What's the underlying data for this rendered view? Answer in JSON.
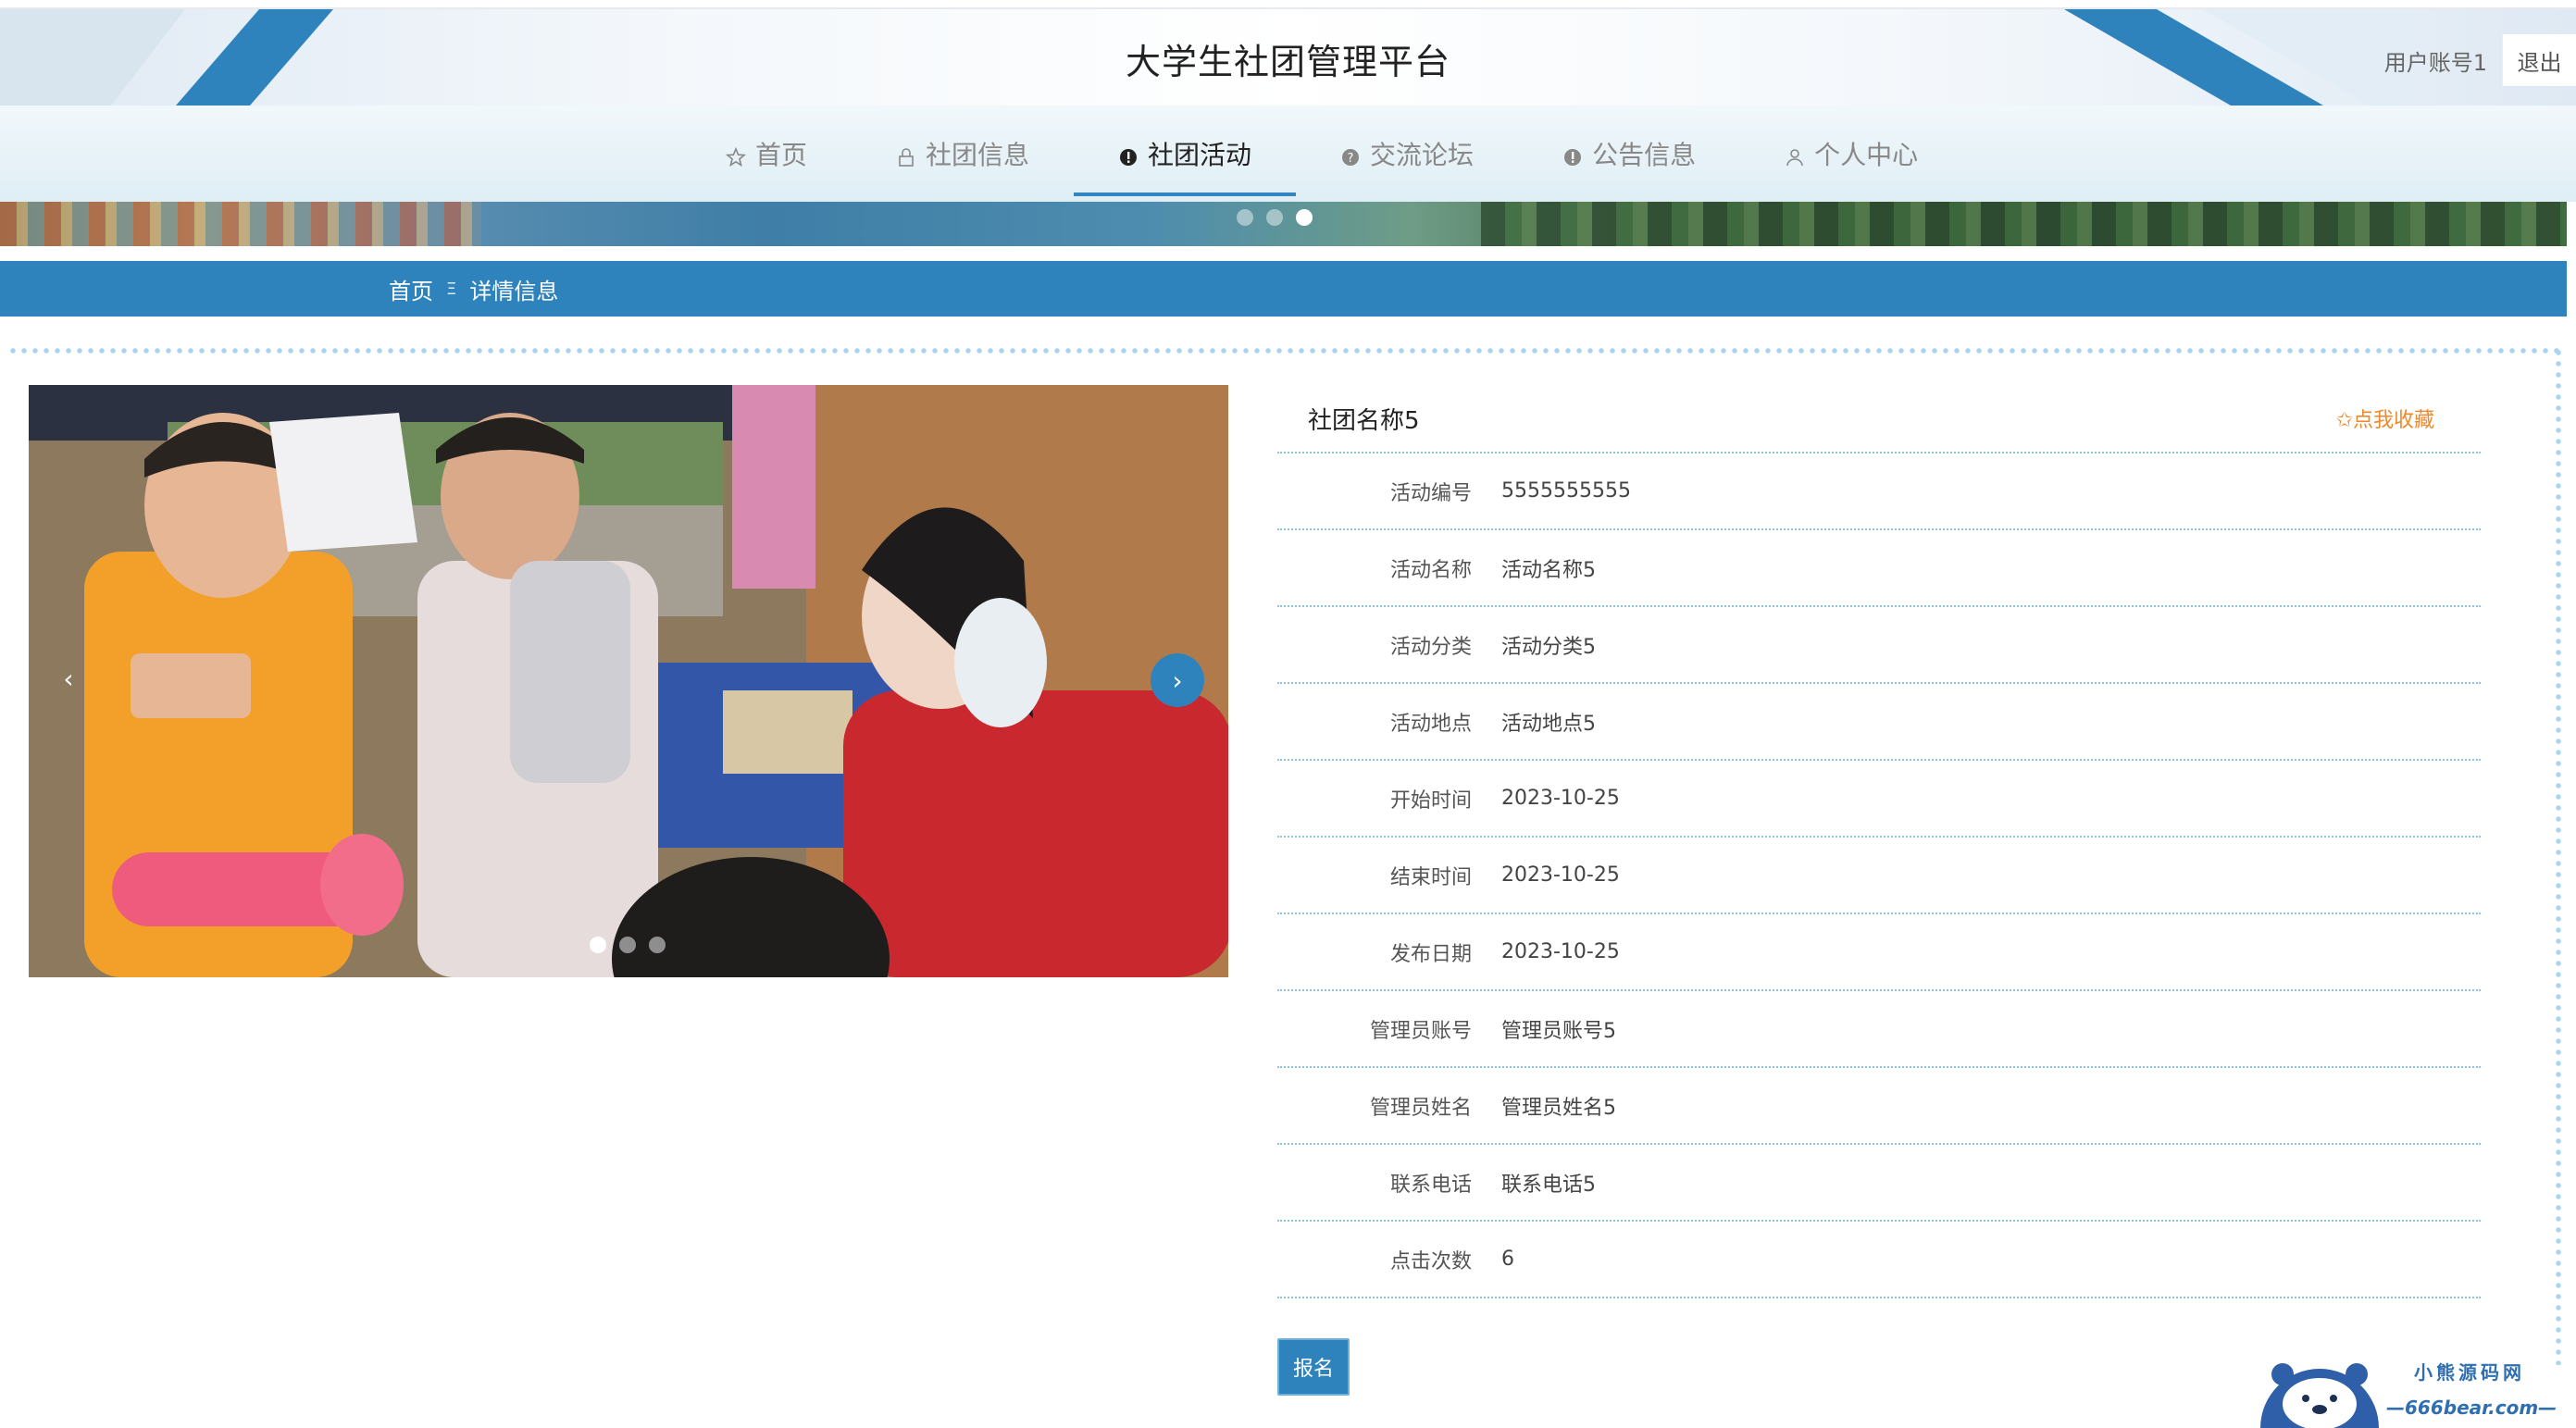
{
  "header": {
    "title": "大学生社团管理平台",
    "user_account": "用户账号1",
    "logout_label": "退出"
  },
  "nav": {
    "items": [
      {
        "label": "首页",
        "icon": "star-icon"
      },
      {
        "label": "社团信息",
        "icon": "lock-icon"
      },
      {
        "label": "社团活动",
        "icon": "info-icon",
        "active": true
      },
      {
        "label": "交流论坛",
        "icon": "question-icon"
      },
      {
        "label": "公告信息",
        "icon": "info-icon"
      },
      {
        "label": "个人中心",
        "icon": "user-icon"
      }
    ]
  },
  "breadcrumb": {
    "home": "首页",
    "separator": "Ξ",
    "current": "详情信息"
  },
  "carousel": {
    "prev_icon": "‹",
    "next_icon": "›"
  },
  "detail": {
    "club_name": "社团名称5",
    "favorite_label": "✩点我收藏",
    "fields": [
      {
        "label": "活动编号",
        "value": "5555555555"
      },
      {
        "label": "活动名称",
        "value": "活动名称5"
      },
      {
        "label": "活动分类",
        "value": "活动分类5"
      },
      {
        "label": "活动地点",
        "value": "活动地点5"
      },
      {
        "label": "开始时间",
        "value": "2023-10-25"
      },
      {
        "label": "结束时间",
        "value": "2023-10-25"
      },
      {
        "label": "发布日期",
        "value": "2023-10-25"
      },
      {
        "label": "管理员账号",
        "value": "管理员账号5"
      },
      {
        "label": "管理员姓名",
        "value": "管理员姓名5"
      },
      {
        "label": "联系电话",
        "value": "联系电话5"
      },
      {
        "label": "点击次数",
        "value": "6"
      }
    ],
    "signup_label": "报名"
  },
  "watermark": {
    "line1": "小熊源码网",
    "line2": "—666bear.com—"
  },
  "colors": {
    "accent": "#2f83bd",
    "favorite": "#ef8a2c",
    "dotted_border": "#8ec3e6"
  }
}
